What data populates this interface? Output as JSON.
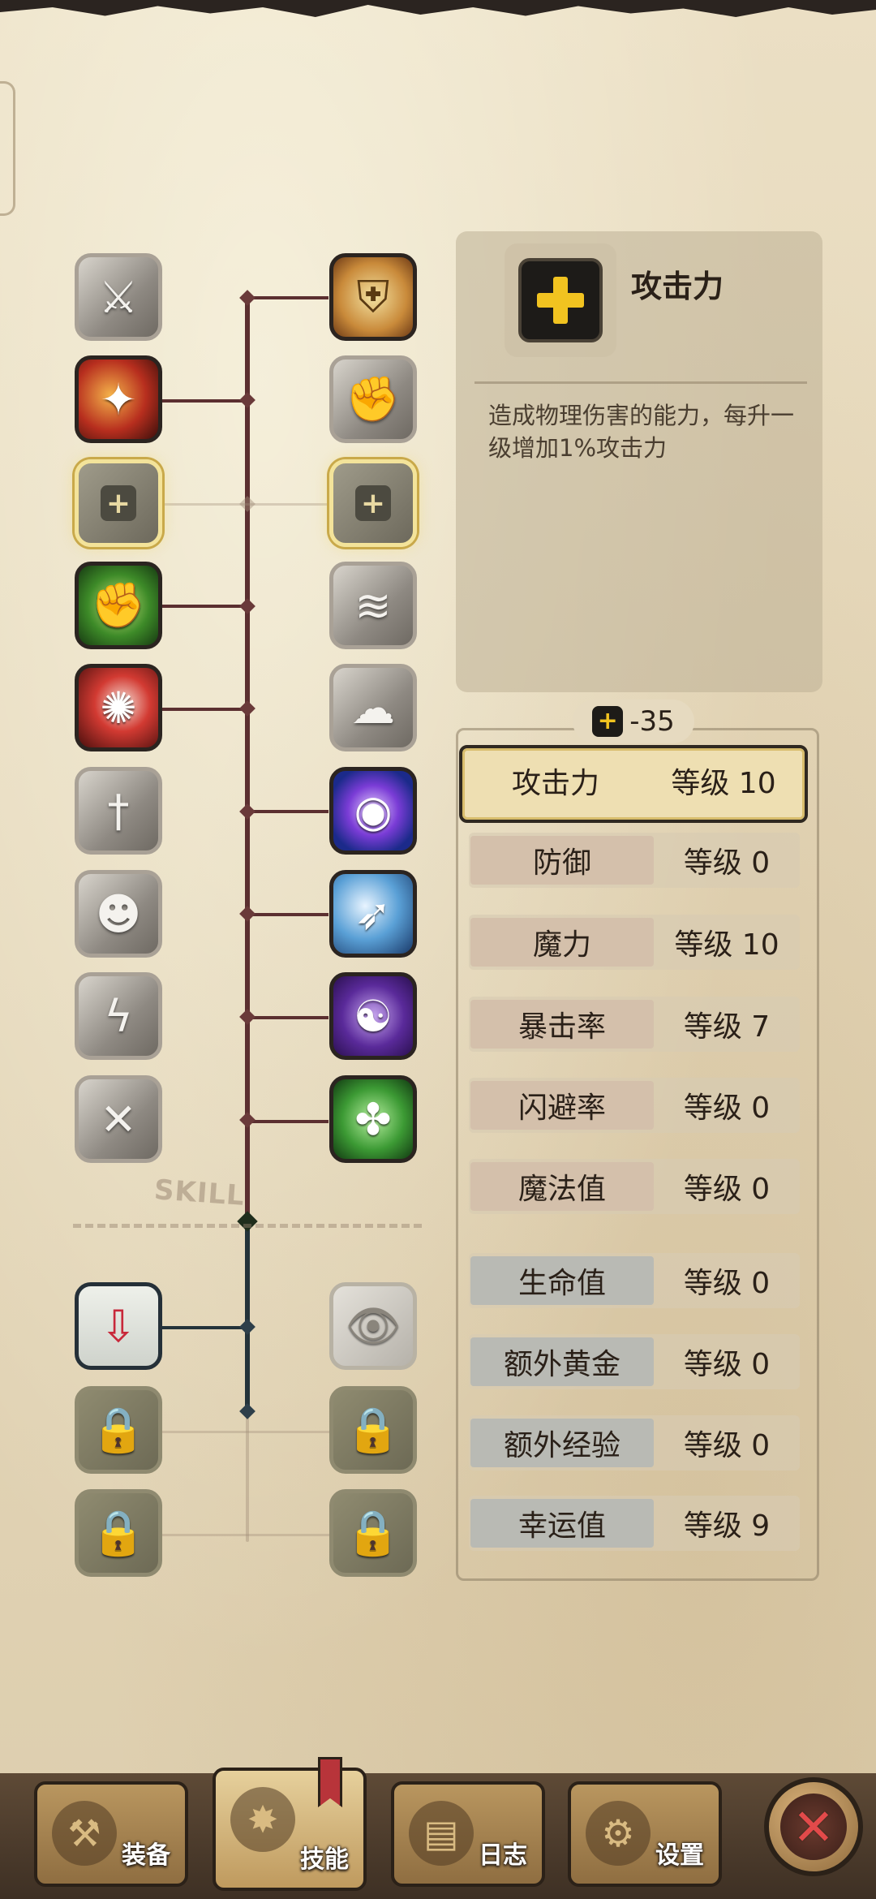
{
  "skill_tree": {
    "divider_label": "SKILL",
    "left_icons": [
      {
        "name": "slash-skill-icon",
        "glyph": "⚔"
      },
      {
        "name": "fire-strike-skill-icon",
        "glyph": "✦"
      },
      {
        "name": "attack-upgrade-skill-icon",
        "glyph": "+"
      },
      {
        "name": "muscle-skill-icon",
        "glyph": "✊"
      },
      {
        "name": "rage-skill-icon",
        "glyph": "✺"
      },
      {
        "name": "sword-skill-icon",
        "glyph": "†"
      },
      {
        "name": "stickman-skill-icon",
        "glyph": "☻"
      },
      {
        "name": "lightning-skill-icon",
        "glyph": "ϟ"
      },
      {
        "name": "blades-skill-icon",
        "glyph": "✕"
      },
      {
        "name": "red-arrow-pedestal-icon",
        "glyph": "⇩"
      },
      {
        "name": "locked-pedestal-icon",
        "glyph": "🔒"
      },
      {
        "name": "locked-cup-icon",
        "glyph": "🔒"
      }
    ],
    "right_icons": [
      {
        "name": "shield-skill-icon",
        "glyph": "⛨"
      },
      {
        "name": "punch-skill-icon",
        "glyph": "✊"
      },
      {
        "name": "defense-upgrade-skill-icon",
        "glyph": "+"
      },
      {
        "name": "dash-skill-icon",
        "glyph": "≋"
      },
      {
        "name": "smoke-skill-icon",
        "glyph": "☁"
      },
      {
        "name": "eye-magic-skill-icon",
        "glyph": "◉"
      },
      {
        "name": "sword-wave-skill-icon",
        "glyph": "➶"
      },
      {
        "name": "purple-orb-skill-icon",
        "glyph": "☯"
      },
      {
        "name": "green-clover-skill-icon",
        "glyph": "✤"
      },
      {
        "name": "eye-pedestal-icon",
        "glyph": "👁"
      },
      {
        "name": "locked-eye-pedestal-icon",
        "glyph": "🔒"
      },
      {
        "name": "locked-hand-icon",
        "glyph": "🔒"
      }
    ]
  },
  "detail": {
    "title": "攻击力",
    "description": "造成物理伤害的能力，每升一级增加1%攻击力"
  },
  "points": "-35",
  "stats": [
    {
      "name": "攻击力",
      "level": "等级 10",
      "tone": "warm",
      "active": true
    },
    {
      "name": "防御",
      "level": "等级 0",
      "tone": "warm",
      "active": false
    },
    {
      "name": "魔力",
      "level": "等级 10",
      "tone": "warm",
      "active": false
    },
    {
      "name": "暴击率",
      "level": "等级 7",
      "tone": "warm",
      "active": false
    },
    {
      "name": "闪避率",
      "level": "等级 0",
      "tone": "warm",
      "active": false
    },
    {
      "name": "魔法值",
      "level": "等级 0",
      "tone": "warm",
      "active": false
    },
    {
      "name": "生命值",
      "level": "等级 0",
      "tone": "cool",
      "active": false
    },
    {
      "name": "额外黄金",
      "level": "等级 0",
      "tone": "cool",
      "active": false
    },
    {
      "name": "额外经验",
      "level": "等级 0",
      "tone": "cool",
      "active": false
    },
    {
      "name": "幸运值",
      "level": "等级 9",
      "tone": "cool",
      "active": false
    }
  ],
  "nav": {
    "equipment": "装备",
    "skills": "技能",
    "journal": "日志",
    "settings": "设置"
  },
  "colors": {
    "accent_yellow": "#f1c320",
    "tree_line": "#5b2f30",
    "close_red": "#e24a4a"
  }
}
